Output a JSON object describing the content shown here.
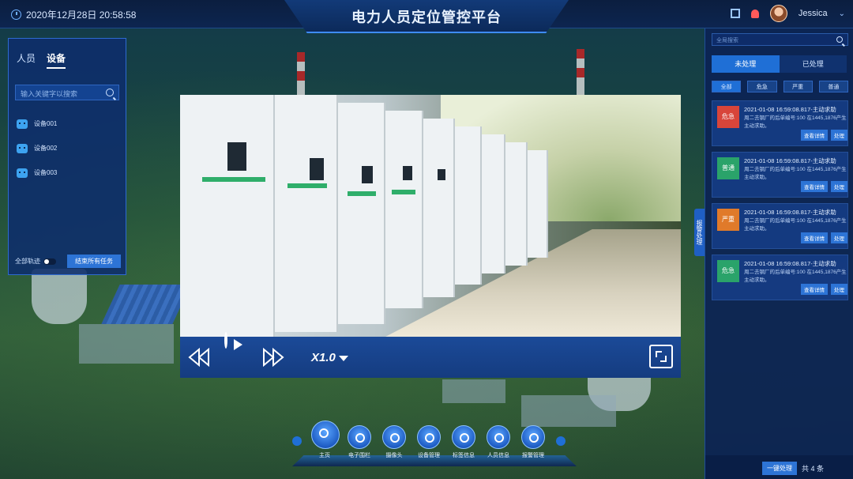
{
  "header": {
    "datetime": "2020年12月28日 20:58:58",
    "title": "电力人员定位管控平台",
    "user_name": "Jessica"
  },
  "left_panel": {
    "tabs": [
      {
        "label": "人员",
        "active": false
      },
      {
        "label": "设备",
        "active": true
      }
    ],
    "search_placeholder": "输入关键字以搜索",
    "devices": [
      "设备001",
      "设备002",
      "设备003"
    ],
    "all_tracks_label": "全部轨迹",
    "end_all_label": "结束所有任务"
  },
  "player": {
    "speed": "X1.0"
  },
  "right_panel": {
    "search_placeholder": "全局搜索",
    "tabs": [
      {
        "label": "未处理",
        "active": true
      },
      {
        "label": "已处理",
        "active": false
      }
    ],
    "filters": [
      {
        "label": "全部",
        "active": true
      },
      {
        "label": "危急",
        "active": false
      },
      {
        "label": "严重",
        "active": false
      },
      {
        "label": "普通",
        "active": false
      }
    ],
    "alarms": [
      {
        "level": "危急",
        "color": "#d8453a",
        "time": "2021-01-08 16:59:08.817-主动求助",
        "desc": "周二去钢厂的后单编号:100 在1445,1876产生主动求助。",
        "detail": "查看详情",
        "handle": "处理"
      },
      {
        "level": "普通",
        "color": "#2aa36a",
        "time": "2021-01-08 16:59:08.817-主动求助",
        "desc": "周二去钢厂的后单编号:100 在1445,1876产生主动求助。",
        "detail": "查看详情",
        "handle": "处理"
      },
      {
        "level": "严重",
        "color": "#e07a2a",
        "time": "2021-01-08 16:59:08.817-主动求助",
        "desc": "周二去钢厂的后单编号:100 在1445,1876产生主动求助。",
        "detail": "查看详情",
        "handle": "处理"
      },
      {
        "level": "危急",
        "color": "#2aa36a",
        "time": "2021-01-08 16:59:08.817-主动求助",
        "desc": "周二去钢厂的后单编号:100 在1445,1876产生主动求助。",
        "detail": "查看详情",
        "handle": "处理"
      }
    ],
    "one_key_label": "一键处理",
    "total_label": "共 4 条",
    "side_tab_label": "报警处理"
  },
  "bottom_nav": [
    {
      "label": "主页",
      "icon": "home-icon"
    },
    {
      "label": "电子围栏",
      "icon": "fence-icon"
    },
    {
      "label": "摄像头",
      "icon": "camera-icon"
    },
    {
      "label": "设备管理",
      "icon": "gear-icon"
    },
    {
      "label": "标签信息",
      "icon": "tag-icon"
    },
    {
      "label": "人员信息",
      "icon": "user-icon"
    },
    {
      "label": "报警管理",
      "icon": "alarm-icon"
    }
  ]
}
